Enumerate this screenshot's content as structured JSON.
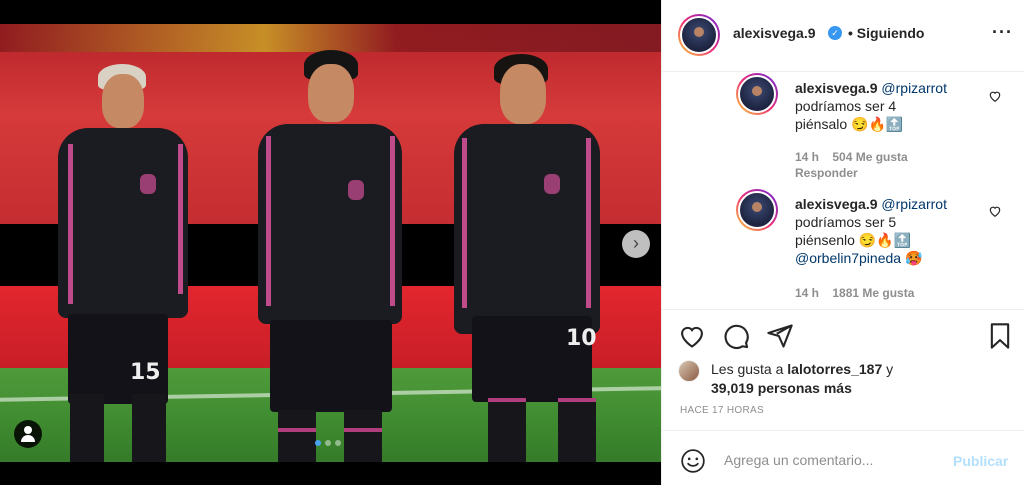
{
  "post": {
    "author": "alexisvega.9",
    "follow_status": "Siguiendo",
    "jersey_numbers": [
      "15",
      "10"
    ],
    "carousel_count": 3,
    "carousel_active": 1
  },
  "comments": [
    {
      "user": "alexisvega.9",
      "mention": "@rpizarrot",
      "line1": "podríamos ser 4",
      "line2": "piénsalo 😏🔥🔝",
      "time": "14 h",
      "likes": "504 Me gusta",
      "reply": "Responder"
    },
    {
      "user": "alexisvega.9",
      "mention": "@rpizarrot",
      "line1": "podríamos ser 5",
      "line2": "piénsenlo 😏🔥🔝",
      "line3_mention": "@orbelin7pineda",
      "line3_emoji": "🥵",
      "time": "14 h",
      "likes": "1881 Me gusta"
    }
  ],
  "likes": {
    "prefix": "Les gusta a",
    "user": "lalotorres_187",
    "joiner": "y",
    "others": "39,019 personas más"
  },
  "timeago": "HACE 17 HORAS",
  "compose": {
    "placeholder": "Agrega un comentario...",
    "publish_label": "Publicar"
  },
  "colors": {
    "link": "#00376b",
    "publish_disabled": "#b2dffc",
    "verified": "#3897f0"
  }
}
